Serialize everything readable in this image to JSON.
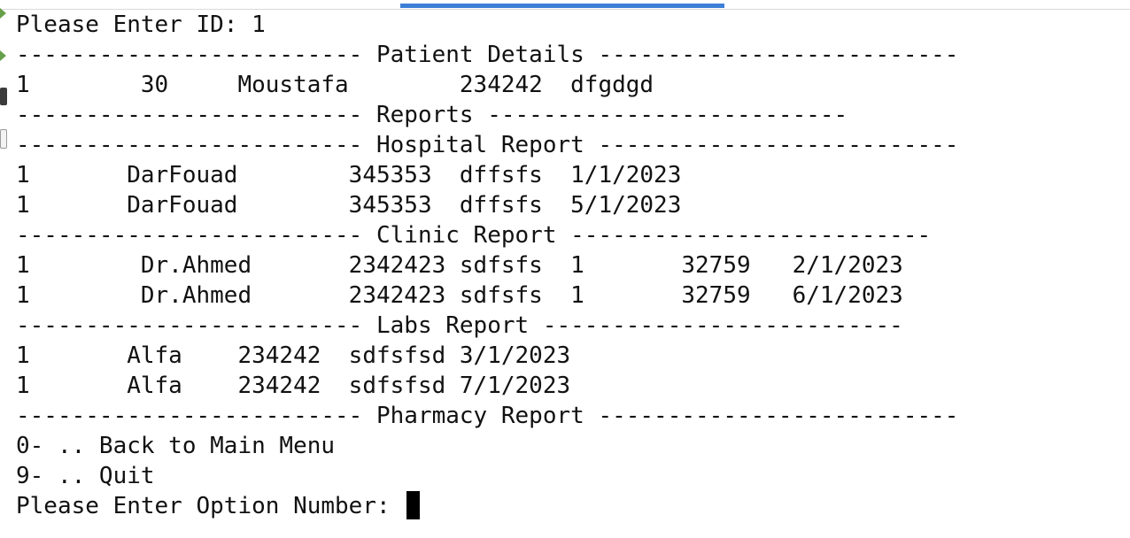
{
  "terminal": {
    "prompt_id": "Please Enter ID: 1",
    "patient_header": "------------------------- Patient Details --------------------------",
    "patient_row": "1        30     Moustafa        234242  dfgdgd",
    "reports_header": "------------------------- Reports --------------------------",
    "hospital_header": "------------------------- Hospital Report --------------------------",
    "hospital_rows": [
      "1       DarFouad        345353  dffsfs  1/1/2023",
      "1       DarFouad        345353  dffsfs  5/1/2023"
    ],
    "clinic_header": "------------------------- Clinic Report --------------------------",
    "clinic_rows": [
      "1        Dr.Ahmed       2342423 sdfsfs  1       32759   2/1/2023",
      "1        Dr.Ahmed       2342423 sdfsfs  1       32759   6/1/2023"
    ],
    "labs_header": "------------------------- Labs Report --------------------------",
    "labs_rows": [
      "1       Alfa    234242  sdfsfsd 3/1/2023",
      "1       Alfa    234242  sdfsfsd 7/1/2023"
    ],
    "pharmacy_header": "------------------------- Pharmacy Report --------------------------",
    "menu_back": "0- .. Back to Main Menu",
    "menu_quit": "9- .. Quit",
    "prompt_option": "Please Enter Option Number: "
  },
  "colors": {
    "background": "#ffffff",
    "text": "#111111",
    "accent": "#3d7fd6",
    "gutter_arrow": "#67a04a"
  },
  "icons": [
    "expand-arrow-icon",
    "expand-arrow-icon",
    "terminal-icon",
    "document-icon"
  ]
}
